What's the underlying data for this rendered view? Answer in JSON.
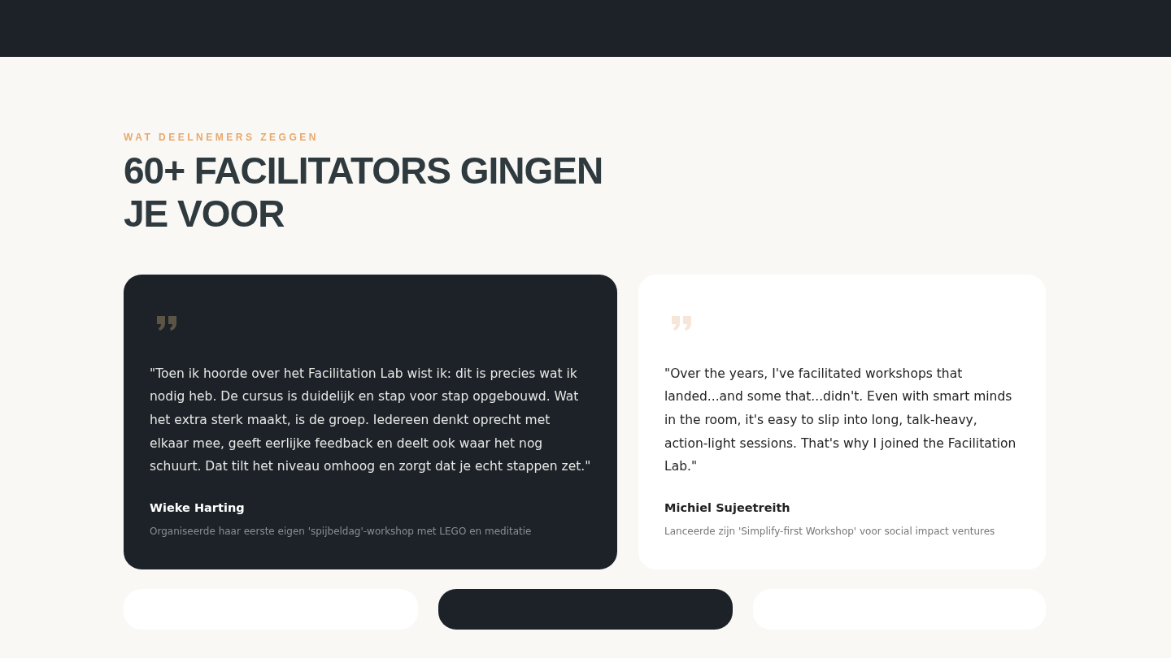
{
  "section": {
    "eyebrow": "WAT DEELNEMERS ZEGGEN",
    "title": "60+ FACILITATORS GINGEN JE VOOR"
  },
  "testimonials": [
    {
      "kind": "dark",
      "quote": "\"Toen ik hoorde over het Facilitation Lab wist ik: dit is precies wat ik nodig heb. De cursus is duidelijk en stap voor stap opgebouwd. Wat het extra sterk maakt, is de groep. Iedereen denkt oprecht met elkaar mee, geeft eerlijke feedback en deelt ook waar het nog schuurt. Dat tilt het niveau omhoog en zorgt dat je echt stappen zet.\"",
      "name": "Wieke Harting",
      "role": "Organiseerde haar eerste eigen 'spijbeldag'-workshop met LEGO en meditatie"
    },
    {
      "kind": "light",
      "quote": "\"Over the years, I've facilitated workshops that landed...and some that...didn't. Even with smart minds in the room, it's easy to slip into long, talk-heavy, action-light sessions. That's why I joined the Facilitation Lab.\"",
      "name": "Michiel Sujeetreith",
      "role": "Lanceerde zijn 'Simplify-first Workshop' voor social impact ventures"
    }
  ],
  "more_cards": [
    {
      "kind": "light"
    },
    {
      "kind": "dark"
    },
    {
      "kind": "light"
    }
  ]
}
